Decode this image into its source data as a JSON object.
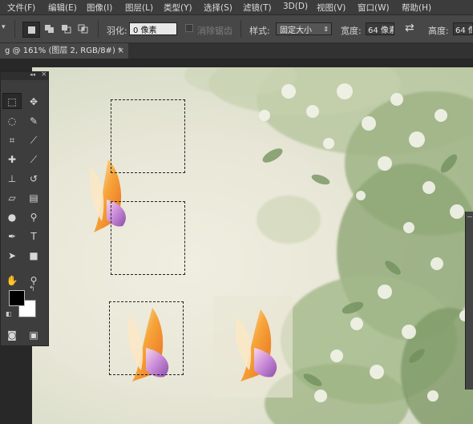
{
  "menubar": {
    "items": [
      "文件(F)",
      "编辑(E)",
      "图像(I)",
      "图层(L)",
      "类型(Y)",
      "选择(S)",
      "滤镜(T)",
      "3D(D)",
      "视图(V)",
      "窗口(W)",
      "帮助(H)"
    ]
  },
  "options": {
    "feather_label": "羽化:",
    "feather_value": "0 像素",
    "antialias_label": "消除锯齿",
    "style_label": "样式:",
    "style_value": "固定大小",
    "width_label": "宽度:",
    "width_value": "64 像素",
    "height_label": "高度:",
    "height_value": "64 像"
  },
  "document": {
    "tab_title": "g @ 161% (图层 2, RGB/8#) *",
    "close_glyph": "×"
  },
  "toolbox": {
    "collapse_glyph": "◂◂",
    "close_glyph": "×",
    "tools": [
      {
        "name": "rectangular-marquee-icon",
        "glyph": "⬚"
      },
      {
        "name": "move-icon",
        "glyph": "✥"
      },
      {
        "name": "lasso-icon",
        "glyph": "◌"
      },
      {
        "name": "quick-selection-icon",
        "glyph": "✎"
      },
      {
        "name": "crop-icon",
        "glyph": "⌗"
      },
      {
        "name": "eyedropper-icon",
        "glyph": "⟋"
      },
      {
        "name": "healing-brush-icon",
        "glyph": "✚"
      },
      {
        "name": "brush-icon",
        "glyph": "⟋"
      },
      {
        "name": "clone-stamp-icon",
        "glyph": "⊥"
      },
      {
        "name": "history-brush-icon",
        "glyph": "↺"
      },
      {
        "name": "eraser-icon",
        "glyph": "▱"
      },
      {
        "name": "gradient-icon",
        "glyph": "▤"
      },
      {
        "name": "blur-icon",
        "glyph": "●"
      },
      {
        "name": "dodge-icon",
        "glyph": "⚲"
      },
      {
        "name": "pen-icon",
        "glyph": "✒"
      },
      {
        "name": "type-icon",
        "glyph": "T"
      },
      {
        "name": "path-selection-icon",
        "glyph": "➤"
      },
      {
        "name": "rectangle-shape-icon",
        "glyph": "■"
      },
      {
        "name": "hand-icon",
        "glyph": "✋"
      },
      {
        "name": "zoom-icon",
        "glyph": "⚲"
      },
      {
        "name": "quick-mask-icon",
        "glyph": "◙"
      },
      {
        "name": "screen-mode-icon",
        "glyph": "▣"
      }
    ],
    "foreground_color": "#000000",
    "background_color": "#ffffff"
  }
}
